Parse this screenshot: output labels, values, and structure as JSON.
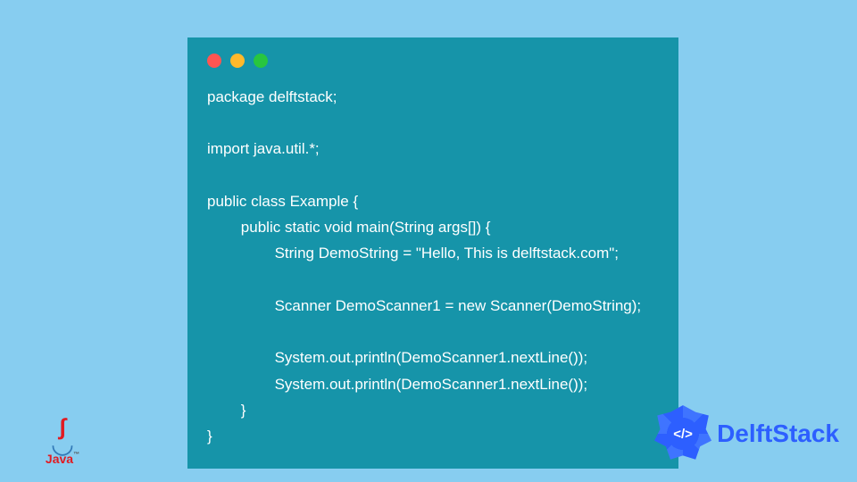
{
  "window": {
    "dot_colors": {
      "red": "#ff5552",
      "yellow": "#ffb92b",
      "green": "#28c63f"
    },
    "background": "#1694a9"
  },
  "code": {
    "language": "java",
    "lines": [
      "package delftstack;",
      "",
      "import java.util.*;",
      "",
      "public class Example {",
      "\tpublic static void main(String args[]) {",
      "\t\tString DemoString = \"Hello, This is delftstack.com\";",
      "",
      "\t\tScanner DemoScanner1 = new Scanner(DemoString);",
      "",
      "\t\tSystem.out.println(DemoScanner1.nextLine());",
      "\t\tSystem.out.println(DemoScanner1.nextLine());",
      "\t}",
      "}"
    ]
  },
  "logos": {
    "java": {
      "label": "Java",
      "tm": "™"
    },
    "delftstack": {
      "label": "DelftStack",
      "badge_glyph": "</>"
    }
  }
}
